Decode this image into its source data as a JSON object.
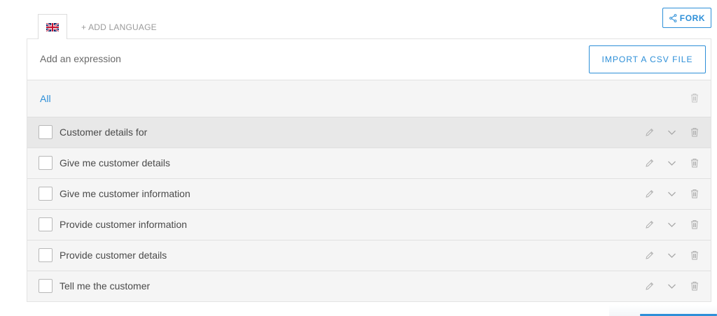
{
  "language_tabs": {
    "active_flag_icon": "uk-flag-icon",
    "add_language_label": "+ ADD LANGUAGE"
  },
  "fork_button": {
    "icon": "fork-icon",
    "label": "FORK"
  },
  "expression_input": {
    "placeholder": "Add an expression",
    "value": ""
  },
  "import_button": {
    "label": "IMPORT A CSV FILE"
  },
  "filter": {
    "label": "All",
    "delete_icon": "trash-icon"
  },
  "expressions": [
    {
      "text": "Customer details for",
      "highlighted": true
    },
    {
      "text": "Give me customer details",
      "highlighted": false
    },
    {
      "text": "Give me customer information",
      "highlighted": false
    },
    {
      "text": "Provide customer information",
      "highlighted": false
    },
    {
      "text": "Provide customer details",
      "highlighted": false
    },
    {
      "text": "Tell me the customer",
      "highlighted": false
    }
  ],
  "row_actions": [
    "pencil-icon",
    "chevron-down-icon",
    "trash-icon"
  ],
  "colors": {
    "accent": "#2d8fd8",
    "panel_bg": "#f5f5f5",
    "highlight_row": "#e8e8e8",
    "icon_gray": "#b0b0b0"
  }
}
